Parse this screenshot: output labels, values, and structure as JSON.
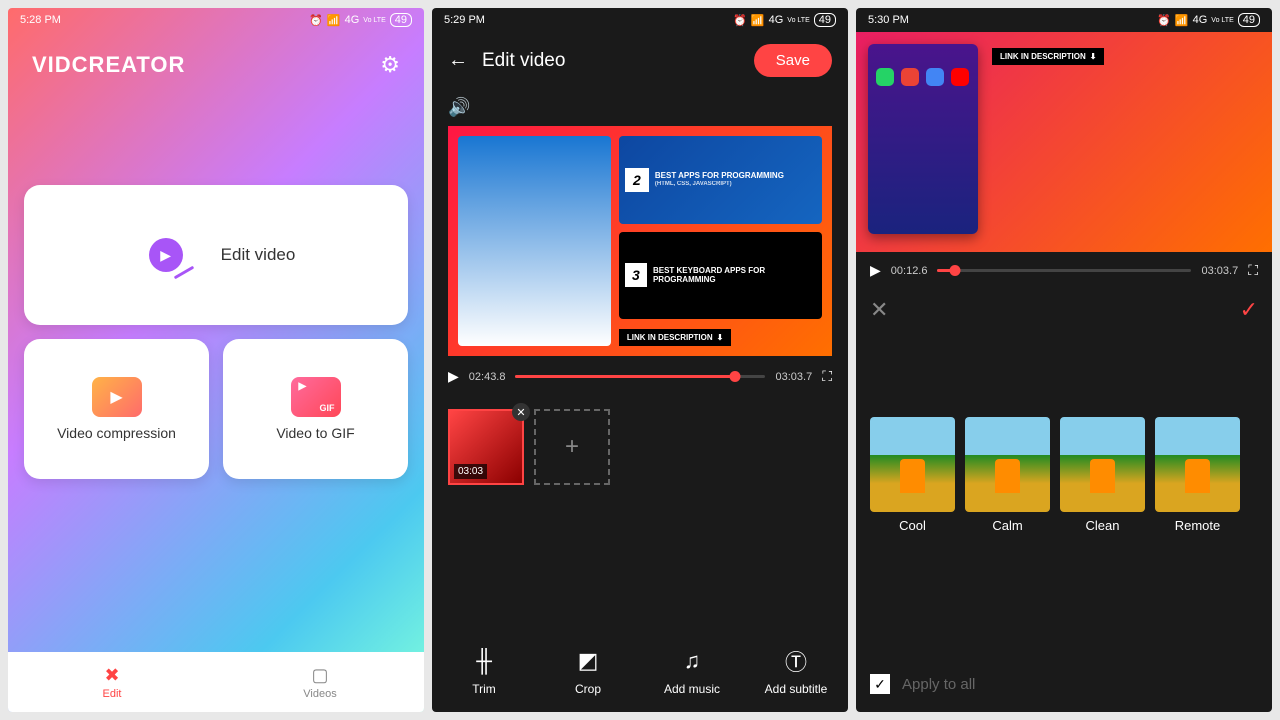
{
  "status": {
    "time1": "5:28 PM",
    "time2": "5:29 PM",
    "time3": "5:30 PM",
    "signal": "4G",
    "carrier": "Vo LTE",
    "battery": "49"
  },
  "p1": {
    "title": "VIDCREATOR",
    "editVideo": "Edit video",
    "compress": "Video compression",
    "gif": "Video to GIF",
    "gifBadge": "GIF",
    "navEdit": "Edit",
    "navVideos": "Videos"
  },
  "p2": {
    "title": "Edit video",
    "save": "Save",
    "card1": "BEST APPS FOR PROGRAMMING",
    "card1sub": "(HTML, CSS, JAVASCRIPT)",
    "card2": "BEST KEYBOARD APPS FOR PROGRAMMING",
    "linkBadge": "LINK IN DESCRIPTION",
    "currentTime": "02:43.8",
    "totalTime": "03:03.7",
    "progressPct": 88,
    "clipTime": "03:03",
    "tools": [
      "Trim",
      "Crop",
      "Add music",
      "Add subtitle"
    ]
  },
  "p3": {
    "linkBadge": "LINK IN DESCRIPTION",
    "currentTime": "00:12.6",
    "totalTime": "03:03.7",
    "progressPct": 7,
    "filters": [
      "Cool",
      "Calm",
      "Clean",
      "Remote"
    ],
    "applyAll": "Apply to all"
  }
}
